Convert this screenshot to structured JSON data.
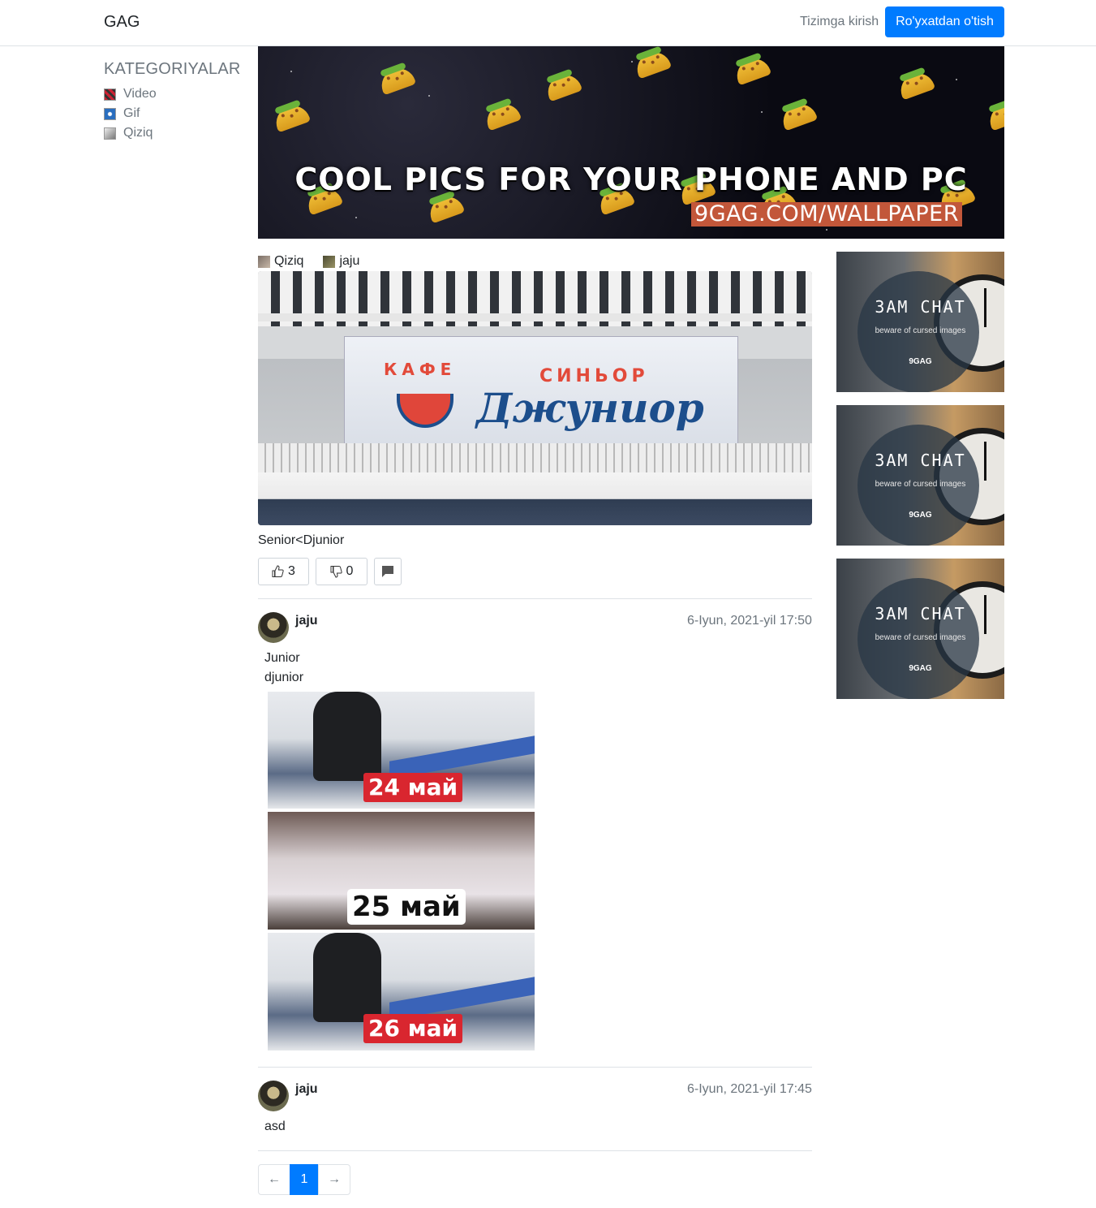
{
  "navbar": {
    "brand": "GAG",
    "login": "Tizimga kirish",
    "register": "Ro'yxatdan o'tish"
  },
  "sidebar": {
    "title": "KATEGORIYALAR",
    "items": [
      {
        "label": "Video",
        "icon": "video-icon"
      },
      {
        "label": "Gif",
        "icon": "gif-icon"
      },
      {
        "label": "Qiziq",
        "icon": "qiziq-icon"
      }
    ]
  },
  "banner": {
    "title": "COOL PICS FOR YOUR PHONE AND PC",
    "url": "9GAG.COM/WALLPAPER"
  },
  "post": {
    "category": "Qiziq",
    "author": "jaju",
    "image_text": {
      "small_left": "КАФЕ",
      "small_right": "СИНЬОР",
      "big": "Джуниор"
    },
    "caption": "Senior<Djunior",
    "likes": "3",
    "dislikes": "0"
  },
  "comments": [
    {
      "author": "jaju",
      "date": "6-Iyun, 2021-yil 17:50",
      "lines": [
        "Junior",
        "djunior"
      ],
      "meme_labels": [
        "24 май",
        "25 май",
        "26 май"
      ]
    },
    {
      "author": "jaju",
      "date": "6-Iyun, 2021-yil 17:45",
      "lines": [
        "asd"
      ]
    }
  ],
  "pagination": {
    "prev": "←",
    "current": "1",
    "next": "→"
  },
  "ads": [
    {
      "title": "ЗАМ СНАТ",
      "subtitle": "beware of cursed images",
      "brand": "9GAG"
    },
    {
      "title": "ЗАМ СНАТ",
      "subtitle": "beware of cursed images",
      "brand": "9GAG"
    },
    {
      "title": "ЗАМ СНАТ",
      "subtitle": "beware of cursed images",
      "brand": "9GAG"
    }
  ],
  "colors": {
    "primary": "#007bff",
    "muted": "#6c757d",
    "border": "#dee2e6"
  }
}
